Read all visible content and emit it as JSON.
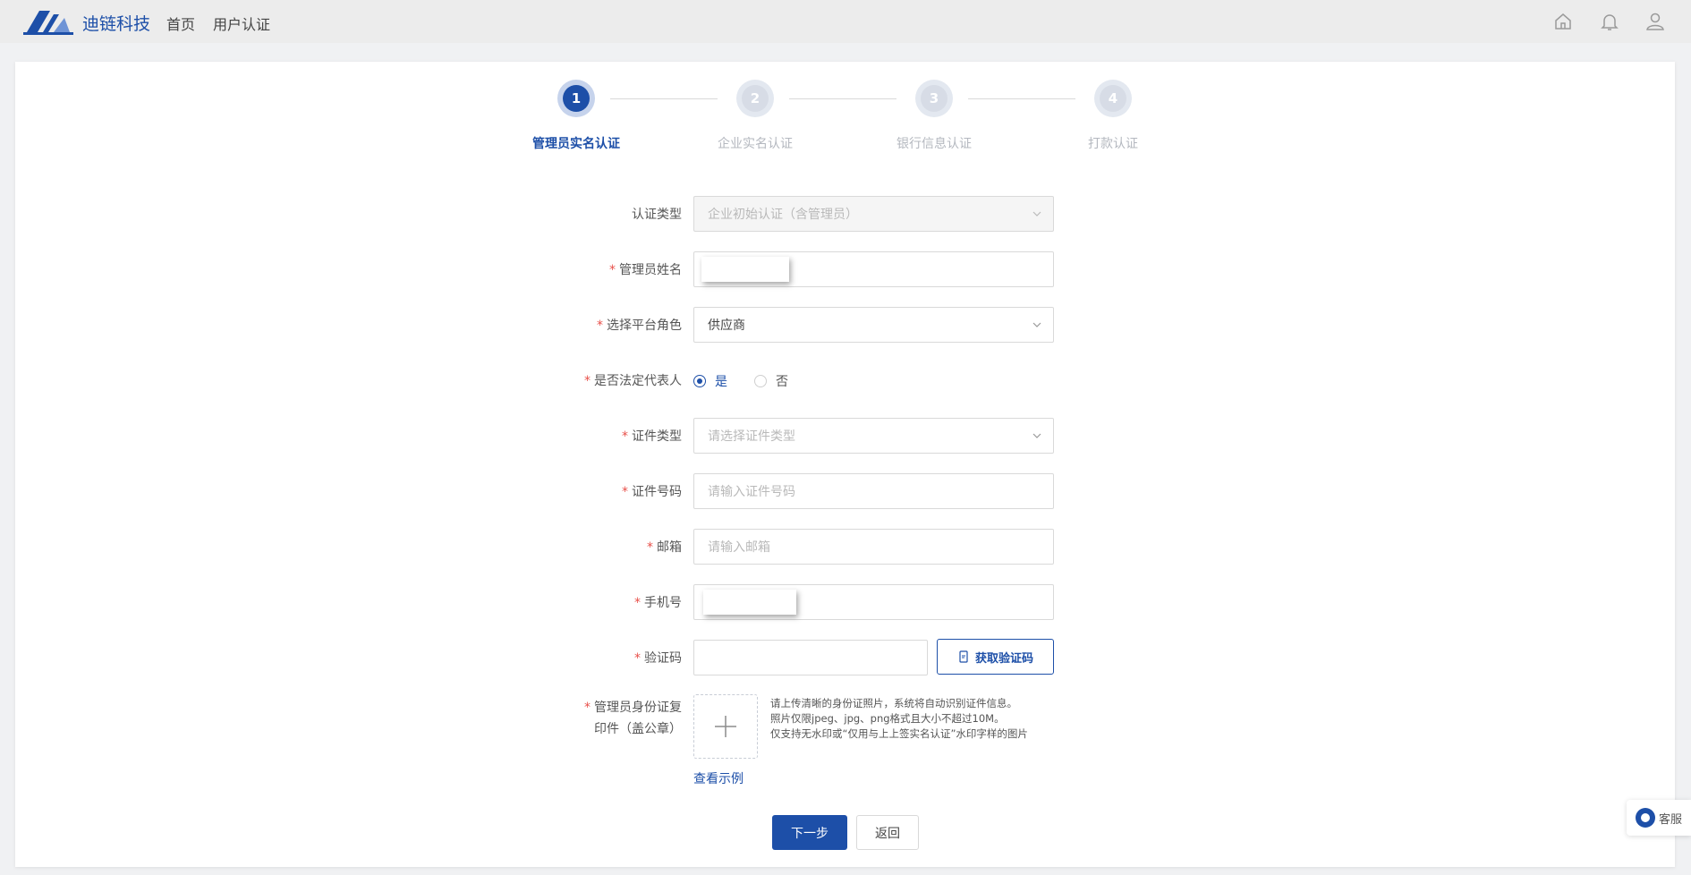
{
  "header": {
    "brand": "迪链科技",
    "nav": [
      "首页",
      "用户认证"
    ],
    "icons": [
      "home-icon",
      "bell-icon",
      "user-icon"
    ]
  },
  "steps": [
    {
      "number": "1",
      "label": "管理员实名认证",
      "active": true
    },
    {
      "number": "2",
      "label": "企业实名认证",
      "active": false
    },
    {
      "number": "3",
      "label": "银行信息认证",
      "active": false
    },
    {
      "number": "4",
      "label": "打款认证",
      "active": false
    }
  ],
  "form": {
    "auth_type": {
      "label": "认证类型",
      "value": "企业初始认证（含管理员）"
    },
    "admin_name": {
      "label": "管理员姓名"
    },
    "platform_role": {
      "label": "选择平台角色",
      "value": "供应商"
    },
    "legal_rep": {
      "label": "是否法定代表人",
      "options": [
        "是",
        "否"
      ],
      "selected": "是"
    },
    "id_type": {
      "label": "证件类型",
      "placeholder": "请选择证件类型"
    },
    "id_number": {
      "label": "证件号码",
      "placeholder": "请输入证件号码"
    },
    "email": {
      "label": "邮箱",
      "placeholder": "请输入邮箱"
    },
    "phone": {
      "label": "手机号"
    },
    "verify_code": {
      "label": "验证码",
      "button": "获取验证码"
    },
    "id_copy": {
      "label_line1": "管理员身份证复",
      "label_line2": "印件（盖公章）",
      "tips": [
        "请上传清晰的身份证照片，系统将自动识别证件信息。",
        "照片仅限jpeg、jpg、png格式且大小不超过10M。",
        "仅支持无水印或“仅用与上上签实名认证”水印字样的图片"
      ],
      "example_link": "查看示例"
    }
  },
  "actions": {
    "next": "下一步",
    "back": "返回"
  },
  "service": {
    "label": "客服"
  },
  "colors": {
    "primary": "#1d4fa8",
    "required": "#e8504a"
  }
}
